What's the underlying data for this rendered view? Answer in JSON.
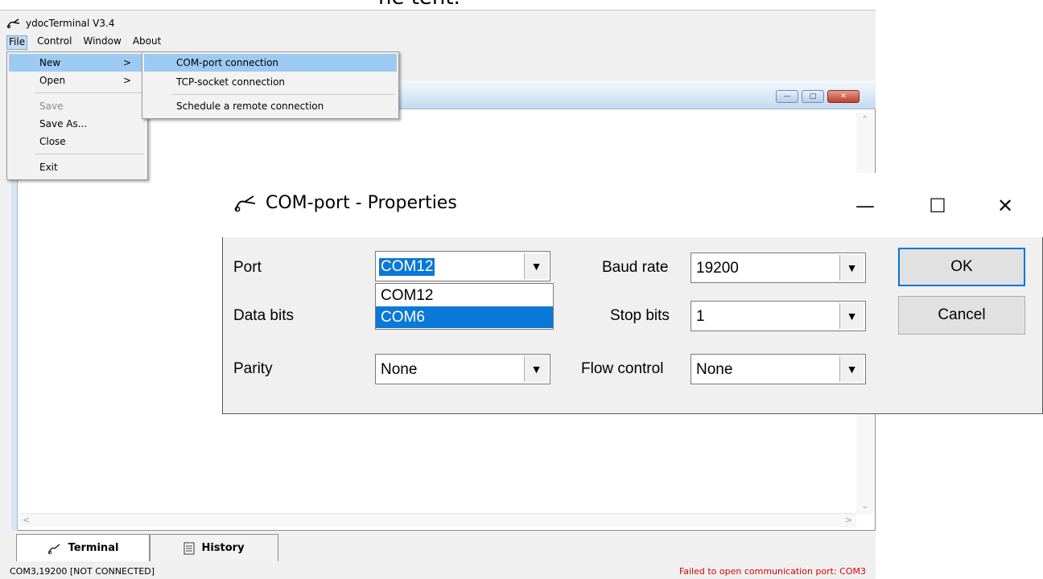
{
  "banner": {
    "text": "ne tent."
  },
  "app": {
    "title": "ydocTerminal V3.4",
    "menu": [
      "File",
      "Control",
      "Window",
      "About"
    ]
  },
  "file_menu": {
    "items": [
      {
        "label": "New",
        "arrow": ">"
      },
      {
        "label": "Open",
        "arrow": ">"
      },
      {
        "label": "Save",
        "disabled": true
      },
      {
        "label": "Save As..."
      },
      {
        "label": "Close"
      },
      {
        "label": "Exit"
      }
    ]
  },
  "new_submenu": {
    "items": [
      "COM-port connection",
      "TCP-socket connection",
      "Schedule a remote connection"
    ]
  },
  "dialog": {
    "title": "COM-port - Properties",
    "labels": {
      "port": "Port",
      "data_bits": "Data bits",
      "parity": "Parity",
      "baud_rate": "Baud rate",
      "stop_bits": "Stop bits",
      "flow_control": "Flow control"
    },
    "values": {
      "port": "COM12",
      "parity": "None",
      "baud_rate": "19200",
      "stop_bits": "1",
      "flow_control": "None"
    },
    "port_options": [
      "COM12",
      "COM6"
    ],
    "buttons": {
      "ok": "OK",
      "cancel": "Cancel"
    },
    "window_buttons": {
      "minimize": "—",
      "maximize": "☐",
      "close": "✕"
    }
  },
  "tabs": {
    "terminal": "Terminal",
    "history": "History"
  },
  "status": {
    "left": "COM3,19200 [NOT CONNECTED]",
    "right": "Failed to open communication port: COM3"
  },
  "colors": {
    "selection": "#0a78d7",
    "menu_highlight": "#9ccaf3",
    "error": "#e00000"
  }
}
